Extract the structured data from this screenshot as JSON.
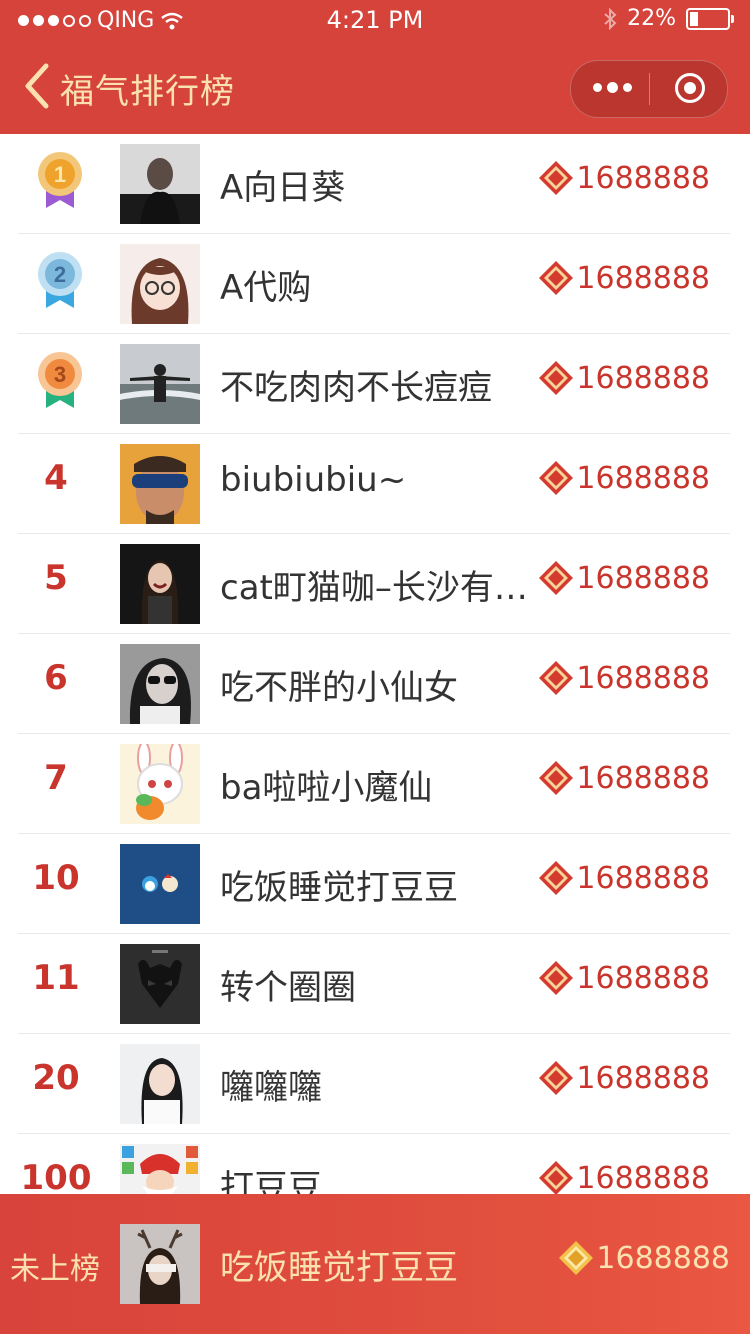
{
  "status_bar": {
    "carrier": "QING",
    "time": "4:21 PM",
    "battery": "22%"
  },
  "nav": {
    "title": "福气排行榜"
  },
  "rows": [
    {
      "rank": "1",
      "name": "A向日葵",
      "score": "1688888",
      "medal": "gold"
    },
    {
      "rank": "2",
      "name": "A代购",
      "score": "1688888",
      "medal": "silver"
    },
    {
      "rank": "3",
      "name": "不吃肉肉不长痘痘",
      "score": "1688888",
      "medal": "bronze"
    },
    {
      "rank": "4",
      "name": "biubiubiu~",
      "score": "1688888"
    },
    {
      "rank": "5",
      "name": "cat町猫咖–长沙有猫咖啡",
      "score": "1688888"
    },
    {
      "rank": "6",
      "name": "吃不胖的小仙女",
      "score": "1688888"
    },
    {
      "rank": "7",
      "name": "ba啦啦小魔仙",
      "score": "1688888"
    },
    {
      "rank": "10",
      "name": "吃饭睡觉打豆豆",
      "score": "1688888"
    },
    {
      "rank": "11",
      "name": "转个圈圈",
      "score": "1688888"
    },
    {
      "rank": "20",
      "name": "囖囖囖",
      "score": "1688888"
    },
    {
      "rank": "100",
      "name": "打豆豆",
      "score": "1688888"
    }
  ],
  "footer": {
    "label": "未上榜",
    "name": "吃饭睡觉打豆豆",
    "score": "1688888"
  },
  "colors": {
    "header": "#d5433a",
    "accent": "#c9342c",
    "gold_text": "#fbe0b0"
  },
  "icons": {
    "fu": "fu-diamond-icon"
  }
}
